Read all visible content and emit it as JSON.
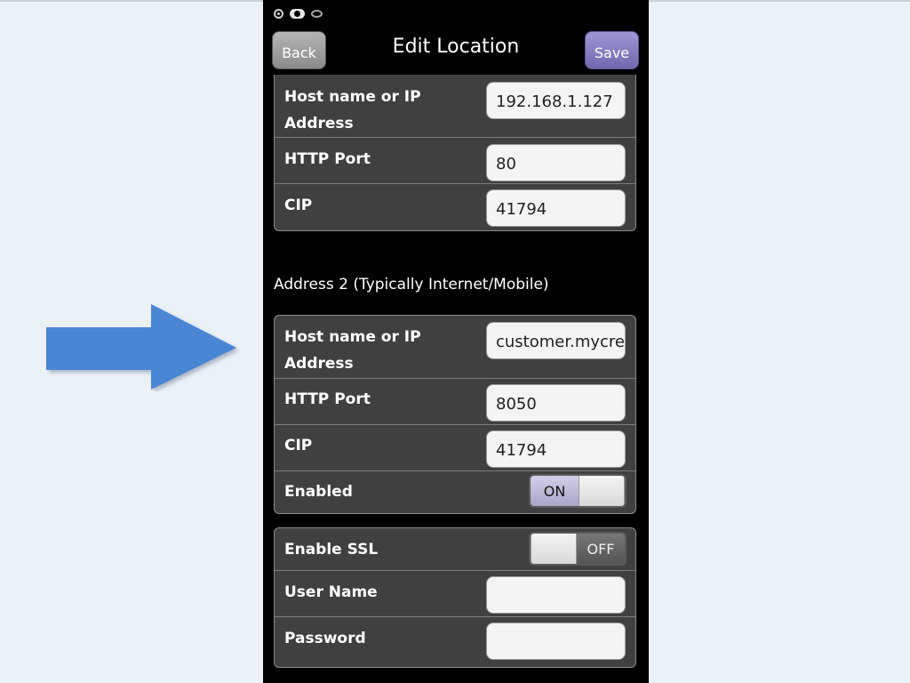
{
  "header": {
    "title": "Edit Location",
    "back_label": "Back",
    "save_label": "Save"
  },
  "address1": {
    "rows": [
      {
        "label": "Host name or IP Address",
        "value": "192.168.1.127"
      },
      {
        "label": "HTTP Port",
        "value": "80"
      },
      {
        "label": "CIP",
        "value": "41794"
      }
    ]
  },
  "address2": {
    "heading": "Address 2 (Typically Internet/Mobile)",
    "rows": [
      {
        "label": "Host name or IP Address",
        "value": "customer.mycre"
      },
      {
        "label": "HTTP Port",
        "value": "8050"
      },
      {
        "label": "CIP",
        "value": "41794"
      }
    ],
    "enabled": {
      "label": "Enabled",
      "state": "ON"
    }
  },
  "security": {
    "ssl": {
      "label": "Enable SSL",
      "state": "OFF"
    },
    "username": {
      "label": "User Name",
      "value": ""
    },
    "password": {
      "label": "Password",
      "value": ""
    }
  },
  "colors": {
    "arrow": "#4a86d4",
    "save_button": "#7a73b8",
    "panel_bg": "#404040"
  },
  "icons": [
    "record-icon",
    "cloud-icon",
    "eye-icon",
    "arrow-right-icon"
  ]
}
